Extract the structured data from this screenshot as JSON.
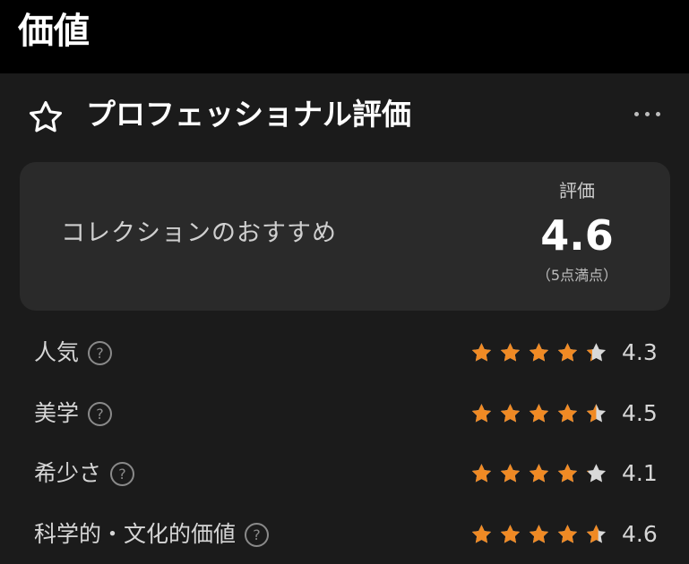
{
  "header": {
    "title": "価値"
  },
  "section": {
    "title": "プロフェッショナル評価",
    "more_icon": "more-horizontal-icon"
  },
  "summary": {
    "label": "コレクションのおすすめ",
    "score_label": "評価",
    "score": "4.6",
    "score_note": "（5点満点）"
  },
  "colors": {
    "star_filled": "#f08a24",
    "star_empty": "#d9d9d9"
  },
  "ratings": [
    {
      "label": "人気",
      "value": "4.3",
      "score": 4.3
    },
    {
      "label": "美学",
      "value": "4.5",
      "score": 4.5
    },
    {
      "label": "希少さ",
      "value": "4.1",
      "score": 4.1
    },
    {
      "label": "科学的・文化的価値",
      "value": "4.6",
      "score": 4.6
    }
  ],
  "help_glyph": "?"
}
